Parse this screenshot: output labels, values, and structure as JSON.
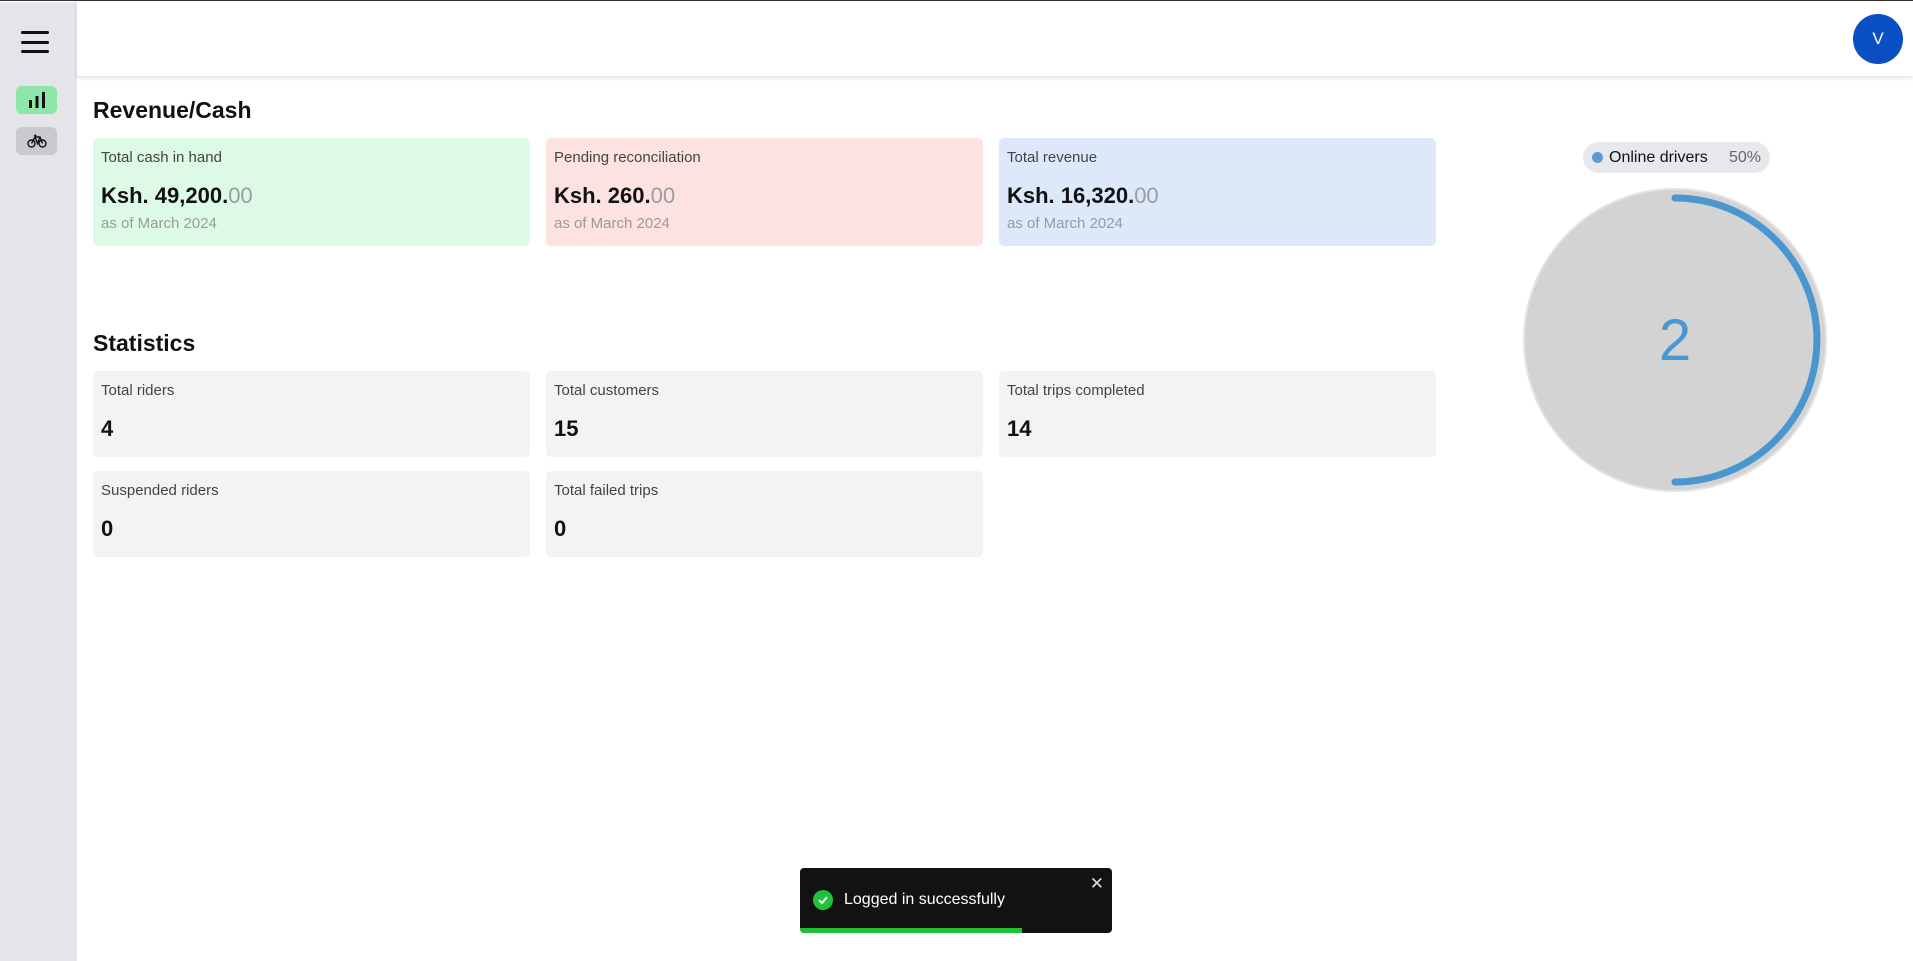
{
  "avatar": {
    "initial": "V"
  },
  "sections": {
    "revenue_title": "Revenue/Cash",
    "stats_title": "Statistics"
  },
  "revenue_cards": [
    {
      "label": "Total cash in hand",
      "amount_main": "Ksh. 49,200.",
      "amount_cents": "00",
      "subtitle": "as of March 2024",
      "color": "#dcfae6"
    },
    {
      "label": "Pending reconciliation",
      "amount_main": "Ksh. 260.",
      "amount_cents": "00",
      "subtitle": "as of March 2024",
      "color": "#fde2e2"
    },
    {
      "label": "Total revenue",
      "amount_main": "Ksh. 16,320.",
      "amount_cents": "00",
      "subtitle": "as of March 2024",
      "color": "#dde9fb"
    }
  ],
  "stats": [
    {
      "label": "Total riders",
      "value": "4"
    },
    {
      "label": "Total customers",
      "value": "15"
    },
    {
      "label": "Total trips completed",
      "value": "14"
    },
    {
      "label": "Suspended riders",
      "value": "0"
    },
    {
      "label": "Total failed trips",
      "value": "0"
    }
  ],
  "gauge": {
    "legend_label": "Online drivers",
    "percent_label": "50%",
    "fraction": 0.5,
    "center_value": "2",
    "color": "#4a97cf"
  },
  "toast": {
    "message": "Logged in successfully",
    "close": "✕",
    "progress": 0.71
  },
  "icons": {
    "menu": "hamburger-icon",
    "dashboard": "bar-chart-icon",
    "riders": "bicycle-icon",
    "success": "check-circle-icon"
  }
}
